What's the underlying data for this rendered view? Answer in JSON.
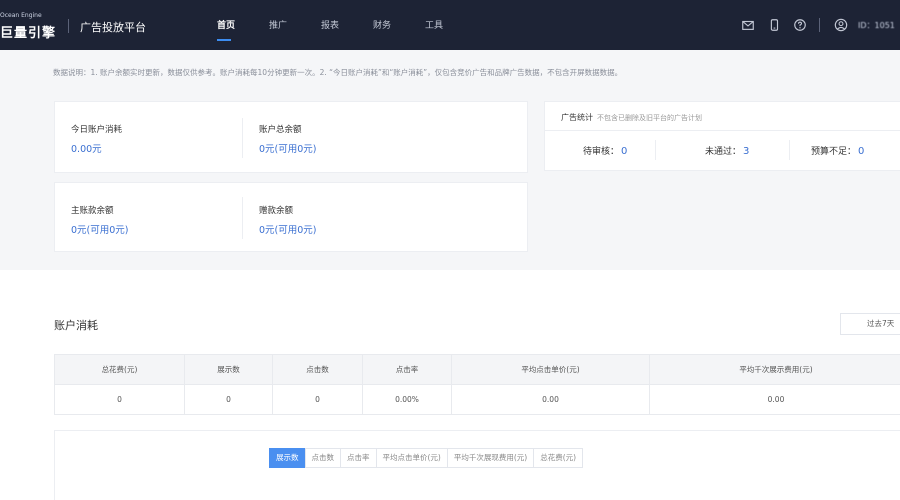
{
  "header": {
    "logo_small": "Ocean Engine",
    "logo_main": "巨量引擎",
    "platform": "广告投放平台",
    "nav": [
      {
        "label": "首页",
        "active": true
      },
      {
        "label": "推广",
        "active": false
      },
      {
        "label": "报表",
        "active": false
      },
      {
        "label": "财务",
        "active": false
      },
      {
        "label": "工具",
        "active": false
      }
    ],
    "user_name": "ID：1051"
  },
  "notice": "数据说明：1. 账户余额实时更新，数据仅供参考。账户消耗每10分钟更新一次。2. “今日账户消耗”和“账户消耗”，仅包含竞价广告和品牌广告数据，不包含开屏数据数据。",
  "account": {
    "today_cost_label": "今日账户消耗",
    "today_cost_value": "0.00元",
    "balance_label": "账户总余额",
    "balance_value": "0元(可用0元)",
    "main_balance_label": "主账款余额",
    "main_balance_value": "0元(可用0元)",
    "grant_balance_label": "赠款余额",
    "grant_balance_value": "0元(可用0元)"
  },
  "ad_stats": {
    "title": "广告统计",
    "subtitle": "不包含已删除及旧平台的广告计划",
    "items": [
      {
        "label": "待审核：",
        "value": "0"
      },
      {
        "label": "未通过：",
        "value": "3"
      },
      {
        "label": "预算不足：",
        "value": "0"
      }
    ]
  },
  "consumption": {
    "title": "账户消耗",
    "range_label": "过去7天",
    "columns": [
      "总花费(元)",
      "展示数",
      "点击数",
      "点击率",
      "平均点击单价(元)",
      "平均千次展示费用(元)"
    ],
    "row": [
      "0",
      "0",
      "0",
      "0.00%",
      "0.00",
      "0.00"
    ],
    "chart_tabs": [
      {
        "label": "展示数",
        "active": true
      },
      {
        "label": "点击数",
        "active": false
      },
      {
        "label": "点击率",
        "active": false
      },
      {
        "label": "平均点击单价(元)",
        "active": false
      },
      {
        "label": "平均千次展现费用(元)",
        "active": false
      },
      {
        "label": "总花费(元)",
        "active": false
      }
    ]
  },
  "colors": {
    "topbar": "#1d2335",
    "accent": "#3a6fd1",
    "tab_active": "#4a8ff0"
  }
}
